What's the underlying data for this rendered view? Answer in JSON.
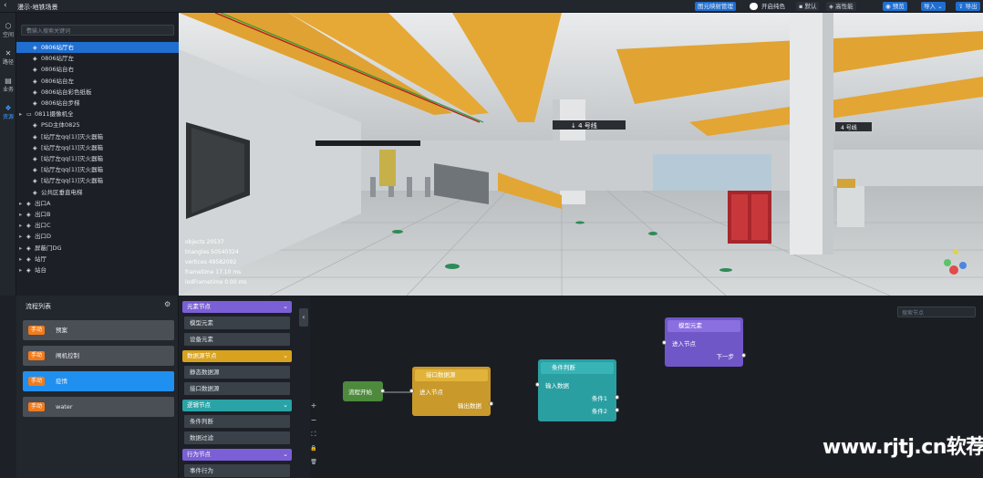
{
  "header": {
    "title": "漫示-地铁场景",
    "back_icon": "chevron-left-icon",
    "buttons": {
      "mapping_manage": "图元映射管理",
      "solid_color": "开启纯色",
      "default": "默认",
      "high_perf": "高性能",
      "preview": "预览",
      "import": "导入",
      "export": "导出"
    }
  },
  "leftnav": {
    "items": [
      {
        "label": "空间",
        "icon": "cube-icon"
      },
      {
        "label": "路径",
        "icon": "path-icon"
      },
      {
        "label": "业务",
        "icon": "document-icon"
      },
      {
        "label": "资源",
        "icon": "resource-icon",
        "active": true
      }
    ]
  },
  "tree": {
    "search_placeholder": "请输入搜索关键词",
    "rows": [
      {
        "label": "0806站厅右",
        "selected": true,
        "indent": 1,
        "arrow": ""
      },
      {
        "label": "0806站厅左",
        "indent": 1,
        "arrow": ""
      },
      {
        "label": "0806站台右",
        "indent": 1,
        "arrow": ""
      },
      {
        "label": "0806站台左",
        "indent": 1,
        "arrow": ""
      },
      {
        "label": "0806站台彩色纸板",
        "indent": 1,
        "arrow": ""
      },
      {
        "label": "0806站台步梯",
        "indent": 1,
        "arrow": ""
      },
      {
        "label": "0811摄像机全",
        "indent": 0,
        "arrow": "▸",
        "folder": true
      },
      {
        "label": "PSD主体0825",
        "indent": 1,
        "arrow": ""
      },
      {
        "label": "[站厅左qq(1)]灭火器箱",
        "indent": 1,
        "arrow": ""
      },
      {
        "label": "[站厅左qq(1)]灭火器箱",
        "indent": 1,
        "arrow": ""
      },
      {
        "label": "[站厅左qq(1)]灭火器箱",
        "indent": 1,
        "arrow": ""
      },
      {
        "label": "[站厅左qq(1)]灭火器箱",
        "indent": 1,
        "arrow": ""
      },
      {
        "label": "[站厅左qq(1)]灭火器箱",
        "indent": 1,
        "arrow": ""
      },
      {
        "label": "公共区垂直电梯",
        "indent": 1,
        "arrow": ""
      },
      {
        "label": "出口A",
        "indent": 0,
        "arrow": "▸"
      },
      {
        "label": "出口B",
        "indent": 0,
        "arrow": "▸"
      },
      {
        "label": "出口C",
        "indent": 0,
        "arrow": "▸"
      },
      {
        "label": "出口D",
        "indent": 0,
        "arrow": "▸"
      },
      {
        "label": "屏蔽门DG",
        "indent": 0,
        "arrow": "▸"
      },
      {
        "label": "站厅",
        "indent": 0,
        "arrow": "▸"
      },
      {
        "label": "站台",
        "indent": 0,
        "arrow": "▸"
      }
    ]
  },
  "viewport_stats": {
    "objects": "objects  20537",
    "triangles": "triangles  50540324",
    "vertices": "vertices  49582092",
    "frametime": "frametime  17.10 ms",
    "lodframetime": "lodFrametime  0.00 ms"
  },
  "flow_list": {
    "title": "流程列表",
    "items": [
      {
        "badge": "手动",
        "label": "预案",
        "active": false
      },
      {
        "badge": "手动",
        "label": "闸机控制",
        "active": false
      },
      {
        "badge": "手动",
        "label": "疫情",
        "active": true
      },
      {
        "badge": "手动",
        "label": "water",
        "active": false
      }
    ]
  },
  "palette": {
    "sections": [
      {
        "title": "元素节点",
        "color": "#7a5fd6",
        "items": [
          "模型元素",
          "设备元素"
        ]
      },
      {
        "title": "数据源节点",
        "color": "#d8a21e",
        "items": [
          "静态数据源",
          "接口数据源"
        ]
      },
      {
        "title": "逻辑节点",
        "color": "#2aa3a6",
        "items": [
          "条件判断",
          "数据过滤"
        ]
      },
      {
        "title": "行为节点",
        "color": "#7a5fd6",
        "items": [
          "事件行为"
        ]
      }
    ]
  },
  "canvas": {
    "search_placeholder": "搜索节点",
    "controls": [
      "+",
      "−",
      "⛶",
      "🔒",
      "🗑"
    ],
    "nodes": {
      "start": {
        "title": "流程开始"
      },
      "api": {
        "title": "接口数据源",
        "in": "进入节点",
        "out": "输出数据"
      },
      "cond": {
        "title": "条件判断",
        "in": "输入数据",
        "out1": "条件1",
        "out2": "条件2"
      },
      "model": {
        "title": "模型元素",
        "in": "进入节点",
        "out": "下一步"
      }
    }
  },
  "watermark": "www.rjtj.cn软荐网"
}
